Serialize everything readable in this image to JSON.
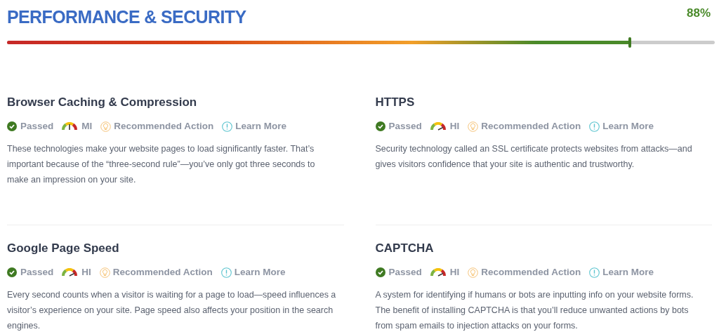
{
  "header": {
    "title": "PERFORMANCE & SECURITY",
    "score": "88%",
    "level": 0.88
  },
  "items": [
    {
      "title": "Browser Caching & Compression",
      "passed": true,
      "status": "Passed",
      "gauge": {
        "kind": "medium",
        "label": "MI"
      },
      "action": "Recommended Action",
      "learn": "Learn More",
      "description": "These technologies make your website pages to load significantly faster. That’s important because of the “three-second rule”—you’ve only got three seconds to make an impression on your site."
    },
    {
      "title": "HTTPS",
      "passed": true,
      "status": "Passed",
      "gauge": {
        "kind": "high",
        "label": "HI"
      },
      "action": "Recommended Action",
      "learn": "Learn More",
      "description": "Security technology called an SSL certificate protects websites from attacks—and gives visitors confidence that your site is authentic and trustworthy."
    },
    {
      "title": "Google Page Speed",
      "passed": true,
      "status": "Passed",
      "gauge": {
        "kind": "high",
        "label": "HI"
      },
      "action": "Recommended Action",
      "learn": "Learn More",
      "description": "Every second counts when a visitor is waiting for a page to load—speed influences a visitor’s experience on your site. Page speed also affects your position in the search engines."
    },
    {
      "title": "CAPTCHA",
      "passed": true,
      "status": "Passed",
      "gauge": {
        "kind": "high",
        "label": "HI"
      },
      "action": "Recommended Action",
      "learn": "Learn More",
      "description": "A system for identifying if humans or bots are inputting info on your website forms. The benefit of installing CAPTCHA is that you’ll reduce unwanted actions by bots from spam emails to injection attacks on your forms."
    }
  ]
}
